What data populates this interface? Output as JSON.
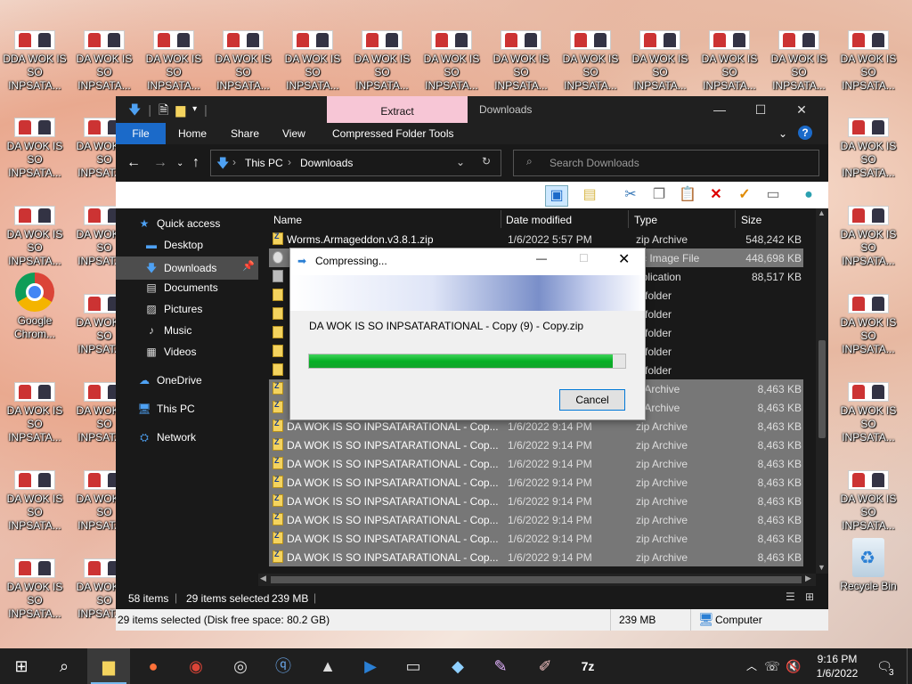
{
  "desktop": {
    "icon_label": "DA WOK IS\nSO INPSATA...",
    "icon_label_first": "DDA WOK IS\nSO INPSATA...",
    "chrome_label": "Google\nChrom...",
    "recycle_label": "Recycle Bin"
  },
  "window": {
    "title": "Downloads",
    "context_tab": "Extract",
    "ribbon_tabs": [
      "File",
      "Home",
      "Share",
      "View",
      "Compressed Folder Tools"
    ],
    "breadcrumb": [
      "This PC",
      "Downloads"
    ],
    "search_placeholder": "Search Downloads",
    "nav": [
      {
        "label": "Quick access",
        "icon": "star-icon"
      },
      {
        "label": "Desktop",
        "icon": "desktop-icon",
        "pinned": true
      },
      {
        "label": "Downloads",
        "icon": "download-icon",
        "pinned": true
      },
      {
        "label": "Documents",
        "icon": "documents-icon",
        "pinned": true
      },
      {
        "label": "Pictures",
        "icon": "pictures-icon",
        "pinned": true
      },
      {
        "label": "Music",
        "icon": "music-icon"
      },
      {
        "label": "Videos",
        "icon": "videos-icon"
      },
      {
        "label": "OneDrive",
        "icon": "cloud-icon"
      },
      {
        "label": "This PC",
        "icon": "computer-icon"
      },
      {
        "label": "Network",
        "icon": "network-icon"
      }
    ],
    "columns": [
      "Name",
      "Date modified",
      "Type",
      "Size"
    ],
    "rows": [
      {
        "name": "Worms.Armageddon.v3.8.1.zip",
        "date": "1/6/2022 5:57 PM",
        "type": "zip Archive",
        "size": "548,242 KB",
        "kind": "zip"
      },
      {
        "name": "",
        "date": "",
        "type": "sc Image File",
        "size": "448,698 KB",
        "kind": "disc",
        "selected": true
      },
      {
        "name": "",
        "date": "",
        "type": "pplication",
        "size": "88,517 KB",
        "kind": "app"
      },
      {
        "name": "",
        "date": "",
        "type": "e folder",
        "size": "",
        "kind": "folder"
      },
      {
        "name": "",
        "date": "",
        "type": "e folder",
        "size": "",
        "kind": "folder"
      },
      {
        "name": "",
        "date": "",
        "type": "e folder",
        "size": "",
        "kind": "folder"
      },
      {
        "name": "",
        "date": "",
        "type": "e folder",
        "size": "",
        "kind": "folder"
      },
      {
        "name": "",
        "date": "",
        "type": "e folder",
        "size": "",
        "kind": "folder"
      },
      {
        "name": "",
        "date": "",
        "type": "p Archive",
        "size": "8,463 KB",
        "kind": "zip",
        "selected": true
      },
      {
        "name": "",
        "date": "",
        "type": "p Archive",
        "size": "8,463 KB",
        "kind": "zip",
        "selected": true
      },
      {
        "name": "DA WOK IS SO INPSATARATIONAL - Cop...",
        "date": "1/6/2022 9:14 PM",
        "type": "zip Archive",
        "size": "8,463 KB",
        "kind": "zip",
        "selected": true
      },
      {
        "name": "DA WOK IS SO INPSATARATIONAL - Cop...",
        "date": "1/6/2022 9:14 PM",
        "type": "zip Archive",
        "size": "8,463 KB",
        "kind": "zip",
        "selected": true
      },
      {
        "name": "DA WOK IS SO INPSATARATIONAL - Cop...",
        "date": "1/6/2022 9:14 PM",
        "type": "zip Archive",
        "size": "8,463 KB",
        "kind": "zip",
        "selected": true
      },
      {
        "name": "DA WOK IS SO INPSATARATIONAL - Cop...",
        "date": "1/6/2022 9:14 PM",
        "type": "zip Archive",
        "size": "8,463 KB",
        "kind": "zip",
        "selected": true
      },
      {
        "name": "DA WOK IS SO INPSATARATIONAL - Cop...",
        "date": "1/6/2022 9:14 PM",
        "type": "zip Archive",
        "size": "8,463 KB",
        "kind": "zip",
        "selected": true
      },
      {
        "name": "DA WOK IS SO INPSATARATIONAL - Cop...",
        "date": "1/6/2022 9:14 PM",
        "type": "zip Archive",
        "size": "8,463 KB",
        "kind": "zip",
        "selected": true
      },
      {
        "name": "DA WOK IS SO INPSATARATIONAL - Cop...",
        "date": "1/6/2022 9:14 PM",
        "type": "zip Archive",
        "size": "8,463 KB",
        "kind": "zip",
        "selected": true
      },
      {
        "name": "DA WOK IS SO INPSATARATIONAL - Cop...",
        "date": "1/6/2022 9:14 PM",
        "type": "zip Archive",
        "size": "8,463 KB",
        "kind": "zip",
        "selected": true
      }
    ],
    "status_items": "58 items",
    "status_selected": "29 items selected",
    "status_size": "239 MB",
    "detail_left": "29 items selected (Disk free space: 80.2 GB)",
    "detail_size": "239 MB",
    "detail_location": "Computer"
  },
  "dialog": {
    "title": "Compressing...",
    "message": "DA WOK IS SO INPSATARATIONAL - Copy (9) - Copy.zip",
    "progress": 0.96,
    "cancel_label": "Cancel"
  },
  "taskbar": {
    "time": "9:16 PM",
    "date": "1/6/2022",
    "notifications": "3",
    "colors": {
      "accent": "#76b9ed",
      "progress": "#06b025",
      "file_tab": "#1b6ac9"
    }
  }
}
